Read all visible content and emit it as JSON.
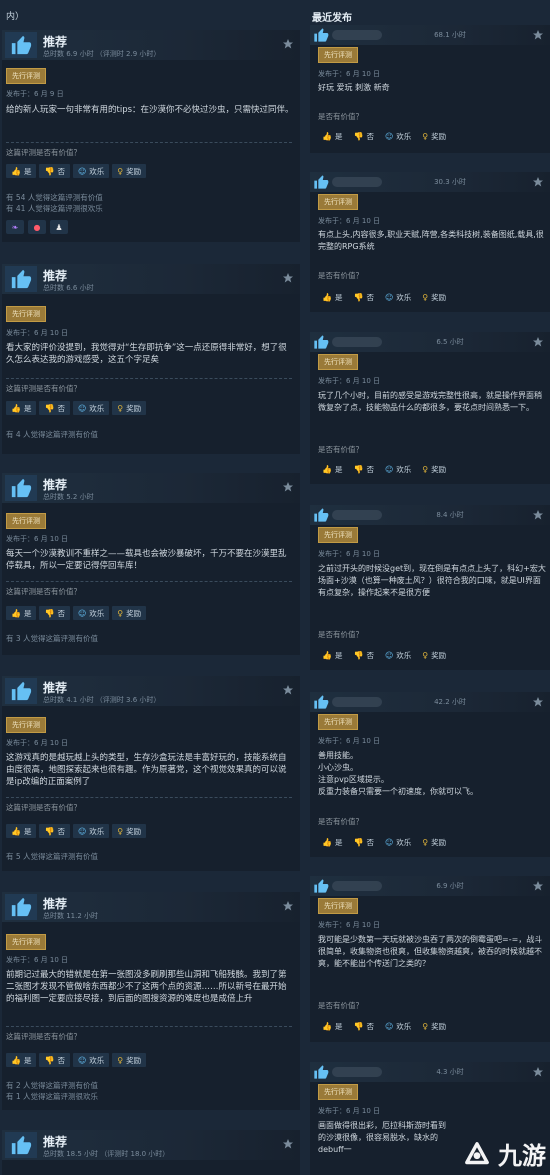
{
  "left": {
    "header": "内）",
    "reviews": [
      {
        "verdict": "推荐",
        "hours": "总时数 6.9 小时 （评测时 2.9 小时）",
        "early_access": "先行评测",
        "posted": "发布于：6 月 9 日",
        "text": "给的新人玩家一句非常有用的tips：在沙漠你不必快过沙虫，只需快过同伴。",
        "helpful_q": "这篇评测是否有价值？",
        "buttons": [
          "是",
          "否",
          "欢乐",
          "奖励"
        ],
        "stats": [
          "有 54 人觉得这篇评测有价值",
          "有 41 人觉得这篇评测很欢乐"
        ],
        "awards": [
          "award-1",
          "award-2",
          "award-3"
        ]
      },
      {
        "verdict": "推荐",
        "hours": "总时数 6.6 小时",
        "early_access": "先行评测",
        "posted": "发布于：6 月 10 日",
        "text": "看大家的评价没提到，我觉得对“生存即抗争”这一点还原得非常好，想了很久怎么表达我的游戏感受，这五个字足矣",
        "helpful_q": "这篇评测是否有价值？",
        "buttons": [
          "是",
          "否",
          "欢乐",
          "奖励"
        ],
        "stats": [
          "有 4 人觉得这篇评测有价值"
        ]
      },
      {
        "verdict": "推荐",
        "hours": "总时数 5.2 小时",
        "early_access": "先行评测",
        "posted": "发布于：6 月 10 日",
        "text": "每天一个沙漠教训不重样之——载具也会被沙暴破坏，千万不要在沙漠里乱停载具，所以一定要记得停回车库！",
        "helpful_q": "这篇评测是否有价值？",
        "buttons": [
          "是",
          "否",
          "欢乐",
          "奖励"
        ],
        "stats": [
          "有 3 人觉得这篇评测有价值"
        ]
      },
      {
        "verdict": "推荐",
        "hours": "总时数 4.1 小时 （评测时 3.6 小时）",
        "early_access": "先行评测",
        "posted": "发布于：6 月 10 日",
        "text": "这游戏真的是越玩越上头的类型，生存沙盒玩法是丰富好玩的，技能系统自由度很高，地图探索起来也很有趣。作为原著党，这个视觉效果真的可以说是ip改编的正面案例了",
        "helpful_q": "这篇评测是否有价值？",
        "buttons": [
          "是",
          "否",
          "欢乐",
          "奖励"
        ],
        "stats": [
          "有 5 人觉得这篇评测有价值"
        ]
      },
      {
        "verdict": "推荐",
        "hours": "总时数 11.2 小时",
        "early_access": "先行评测",
        "posted": "发布于：6 月 10 日",
        "text": "前期记过最大的错就是在第一张图没多刷刷那些山洞和飞船残骸。我到了第二张图才发现不管做啥东西都少不了这两个点的资源……所以新号在最开始的福利图一定要应接尽接，到后面的图搜资源的难度也是成倍上升",
        "helpful_q": "这篇评测是否有价值？",
        "buttons": [
          "是",
          "否",
          "欢乐",
          "奖励"
        ],
        "stats": [
          "有 2 人觉得这篇评测有价值",
          "有 1 人觉得这篇评测很欢乐"
        ]
      },
      {
        "verdict": "推荐",
        "hours": "总时数 18.5 小时 （评测时 18.0 小时）"
      }
    ]
  },
  "right": {
    "header": "最近发布",
    "reviews": [
      {
        "hours": "68.1 小时",
        "early_access": "先行评测",
        "posted": "发布于：6 月 10 日",
        "text": "好玩 爱玩 刺激 新奇",
        "helpful_q": "是否有价值？",
        "buttons": [
          "是",
          "否",
          "欢乐",
          "奖励"
        ]
      },
      {
        "hours": "30.3 小时",
        "early_access": "先行评测",
        "posted": "发布于：6 月 10 日",
        "text": "有点上头,内容很多,职业天赋,阵营,各类科技树,装备图纸,载具,很完整的RPG系统",
        "helpful_q": "是否有价值？",
        "buttons": [
          "是",
          "否",
          "欢乐",
          "奖励"
        ]
      },
      {
        "hours": "6.5 小时",
        "early_access": "先行评测",
        "posted": "发布于：6 月 10 日",
        "text": "玩了几个小时，目前的感受是游戏完整性很高，就是操作界面稍微复杂了点，技能物品什么的都很多，要花点时间熟悉一下。",
        "helpful_q": "是否有价值？",
        "buttons": [
          "是",
          "否",
          "欢乐",
          "奖励"
        ]
      },
      {
        "hours": "8.4 小时",
        "early_access": "先行评测",
        "posted": "发布于：6 月 10 日",
        "text": "之前过开头的时候没get到，现在倒是有点点上头了，科幻+宏大场面+沙漠（也算一种废土风？）很符合我的口味，就是UI界面有点复杂，操作起来不是很方便",
        "helpful_q": "是否有价值？",
        "buttons": [
          "是",
          "否",
          "欢乐",
          "奖励"
        ]
      },
      {
        "hours": "42.2 小时",
        "early_access": "先行评测",
        "posted": "发布于：6 月 10 日",
        "text_lines": [
          "善用技能。",
          "小心沙虫。",
          "注意pvp区域提示。",
          "反重力装备只需要一个初速度，你就可以飞。"
        ],
        "helpful_q": "是否有价值？",
        "buttons": [
          "是",
          "否",
          "欢乐",
          "奖励"
        ]
      },
      {
        "hours": "6.9 小时",
        "early_access": "先行评测",
        "posted": "发布于：6 月 10 日",
        "text": "我可能是少数第一天玩就被沙虫吞了两次的倒霉蛋吧=-=，战斗很简单，收集物资也很爽，但收集物资越爽，被吞的时候就越不爽，能不能出个传送门之类的？",
        "helpful_q": "是否有价值？",
        "buttons": [
          "是",
          "否",
          "欢乐",
          "奖励"
        ]
      },
      {
        "hours": "4.3 小时",
        "early_access": "先行评测",
        "posted": "发布于：6 月 10 日",
        "text": "画面做得很出彩，厄拉科斯游时看到的沙漠很像，很容易脱水，缺水的debuff一"
      }
    ]
  },
  "watermark": "九游"
}
